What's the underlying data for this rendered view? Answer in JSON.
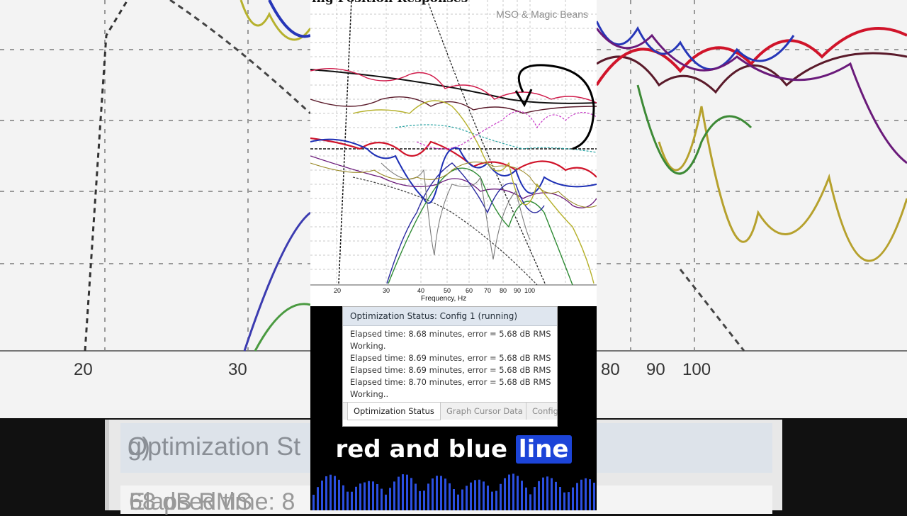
{
  "chart": {
    "title": "ing Position Responses",
    "watermark": "MSO & Magic Beans",
    "xlabel": "Frequency, Hz",
    "xticks": [
      "20",
      "30",
      "40",
      "50",
      "60",
      "70",
      "80",
      "90",
      "100"
    ]
  },
  "background": {
    "ticks": [
      "20",
      "30",
      "80",
      "90",
      "100"
    ],
    "blurred_tab": "Optimization St",
    "blurred_tab_tail": "g)",
    "blurred_line": "Elapsed time: 8",
    "blurred_line_tail": "68 dB RMS"
  },
  "status": {
    "header": "Optimization Status: Config 1 (running)",
    "log": [
      "Elapsed time: 8.68 minutes, error = 5.68 dB RMS",
      "Working.",
      "Elapsed time: 8.69 minutes, error = 5.68 dB RMS",
      "Elapsed time: 8.69 minutes, error = 5.68 dB RMS",
      "Elapsed time: 8.70 minutes, error = 5.68 dB RMS",
      "Working.."
    ],
    "tabs": [
      "Optimization Status",
      "Graph Cursor Data",
      "Config"
    ]
  },
  "caption": {
    "text": "red and blue",
    "highlight": "line"
  },
  "colors": {
    "highlight": "#1c44d8",
    "waveform": "#2b4fe0",
    "panel_bg": "#dfe6ef"
  }
}
